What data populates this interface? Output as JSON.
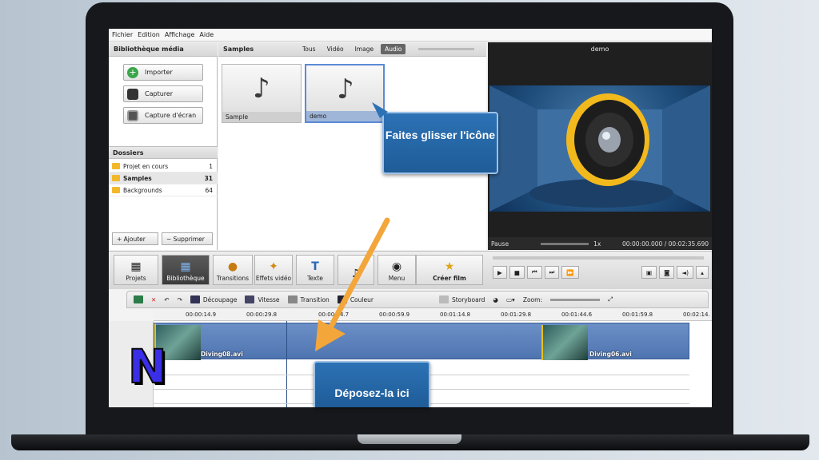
{
  "menu": [
    "Fichier",
    "Edition",
    "Affichage",
    "Aide"
  ],
  "library": {
    "title": "Bibliothèque média",
    "buttons": [
      "Importer",
      "Capturer",
      "Capture d'écran"
    ],
    "folders_title": "Dossiers",
    "folders": [
      {
        "name": "Projet en cours",
        "count": "1"
      },
      {
        "name": "Samples",
        "count": "31"
      },
      {
        "name": "Backgrounds",
        "count": "64"
      }
    ],
    "add_label": "+ Ajouter",
    "remove_label": "− Supprimer"
  },
  "samples": {
    "title": "Samples",
    "tabs": [
      "Tous",
      "Vidéo",
      "Image",
      "Audio"
    ],
    "active_tab": "Audio",
    "items": [
      {
        "name": "Sample"
      },
      {
        "name": "demo"
      }
    ]
  },
  "preview": {
    "title": "demo",
    "status": "Pause",
    "speed": "1x",
    "time": "00:00:00.000 / 00:02:35.690"
  },
  "toolbar": {
    "items": [
      "Projets",
      "Bibliothèque",
      "Transitions",
      "Effets vidéo",
      "Texte",
      "Menu",
      "Créer film"
    ],
    "active": "Bibliothèque"
  },
  "timeline_tools": {
    "items": [
      "Découpage",
      "Vitesse",
      "Transition",
      "Couleur",
      "Storyboard"
    ],
    "zoom_label": "Zoom:"
  },
  "ruler": [
    "00:00:14.9",
    "00:00:29.8",
    "00:00:44.7",
    "00:00:59.9",
    "00:01:14.8",
    "00:01:29.8",
    "00:01:44.6",
    "00:01:59.8",
    "00:02:14."
  ],
  "clips": [
    "Diving08.avi",
    "Diving06.avi"
  ],
  "callouts": {
    "drag": "Faites glisser l'icône",
    "drop": "Déposez-la ici"
  },
  "colors": {
    "accent": "#2c72b5",
    "arrow": "#f3a63a",
    "logo": "#3a2ee6"
  },
  "logo_text": "N"
}
